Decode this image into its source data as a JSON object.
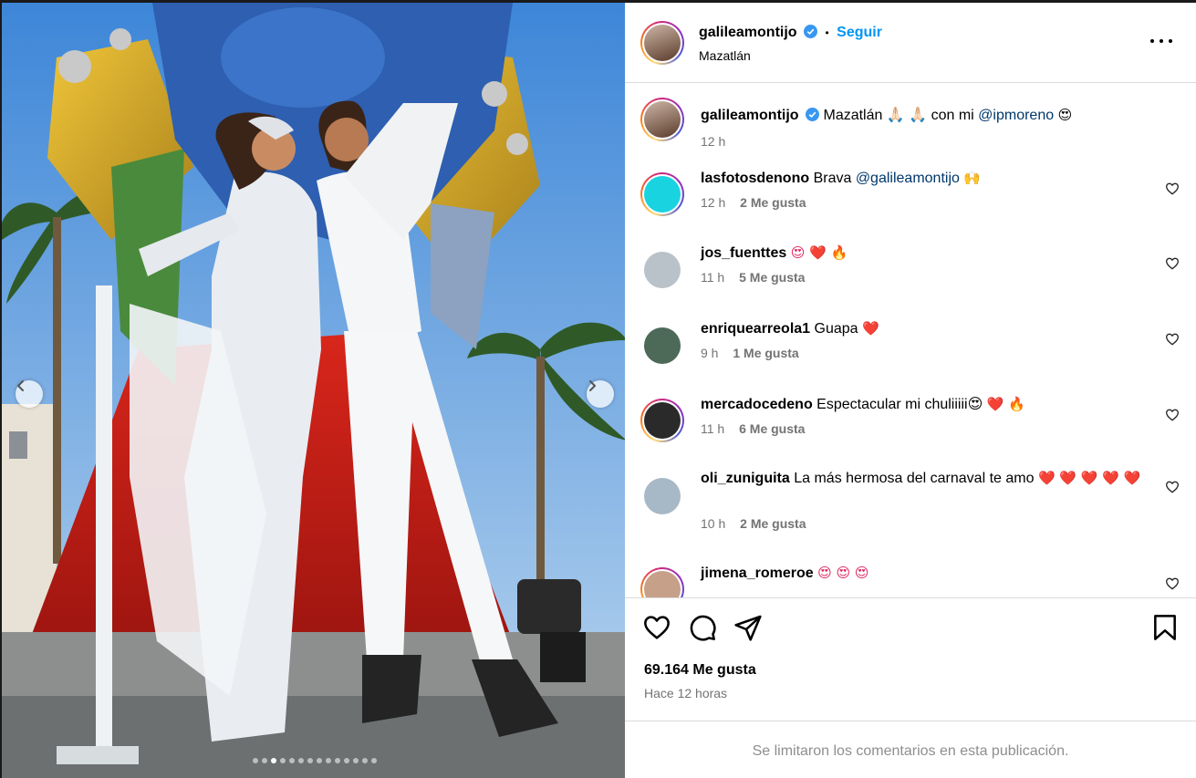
{
  "post": {
    "username": "galileamontijo",
    "follow_label": "Seguir",
    "location": "Mazatlán",
    "separator": "•",
    "caption": {
      "text_before": "Mazatlán 🙏🏻 🙏🏻 con mi",
      "mention": "@ipmoreno",
      "text_after": "😍",
      "time": "12 h"
    }
  },
  "comments": [
    {
      "user": "lasfotosdenono",
      "text": "Brava",
      "mention": "@galileamontijo",
      "after": "🙌",
      "time": "12 h",
      "likes": "2 Me gusta",
      "avatar_color": "#19d3e0"
    },
    {
      "user": "jos_fuenttes",
      "text": "",
      "mention": "",
      "after": "😍 ❤️ 🔥",
      "time": "11 h",
      "likes": "5 Me gusta",
      "avatar_color": "#b9c2c9"
    },
    {
      "user": "enriquearreola1",
      "text": "Guapa",
      "mention": "",
      "after": "❤️",
      "time": "9 h",
      "likes": "1 Me gusta",
      "avatar_color": "#4d6a58"
    },
    {
      "user": "mercadocedeno",
      "text": "Espectacular mi chuliiiii😍",
      "mention": "",
      "after": "❤️ 🔥",
      "time": "11 h",
      "likes": "6 Me gusta",
      "avatar_color": "#2a2a2a"
    },
    {
      "user": "oli_zuniguita",
      "text": "La más hermosa del carnaval te amo",
      "mention": "",
      "after": "❤️ ❤️ ❤️ ❤️ ❤️",
      "time": "10 h",
      "likes": "2 Me gusta",
      "avatar_color": "#a7b8c6"
    },
    {
      "user": "jimena_romeroe",
      "text": "",
      "mention": "",
      "after": "😍 😍 😍",
      "time": "",
      "likes": "",
      "avatar_color": "#c7a08a"
    }
  ],
  "actions": {
    "likes": "69.164 Me gusta",
    "posted": "Hace 12 horas",
    "limited_notice": "Se limitaron los comentarios en esta publicación."
  },
  "carousel": {
    "total": 14,
    "active_index": 2
  },
  "icons": {
    "like": "heart-icon",
    "comment": "comment-icon",
    "share": "share-icon",
    "save": "bookmark-icon",
    "more": "more-icon",
    "prev": "chevron-left-icon",
    "next": "chevron-right-icon"
  },
  "colors": {
    "link": "#0095f6",
    "mention": "#00376b",
    "muted": "#737373",
    "verified": "#3897f0"
  }
}
